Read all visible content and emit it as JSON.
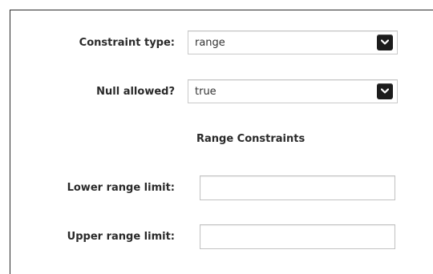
{
  "form": {
    "constraint_type": {
      "label": "Constraint type:",
      "value": "range"
    },
    "null_allowed": {
      "label": "Null allowed?",
      "value": "true"
    },
    "section_title": "Range Constraints",
    "lower_limit": {
      "label": "Lower range limit:",
      "value": "",
      "placeholder": ""
    },
    "upper_limit": {
      "label": "Upper range limit:",
      "value": "",
      "placeholder": ""
    }
  },
  "icons": {
    "dropdown": "chevron-down-icon"
  },
  "colors": {
    "dropdown_button": "#1c1c1c",
    "label_text": "#2a2a2a",
    "input_border": "#c2c2c2"
  }
}
